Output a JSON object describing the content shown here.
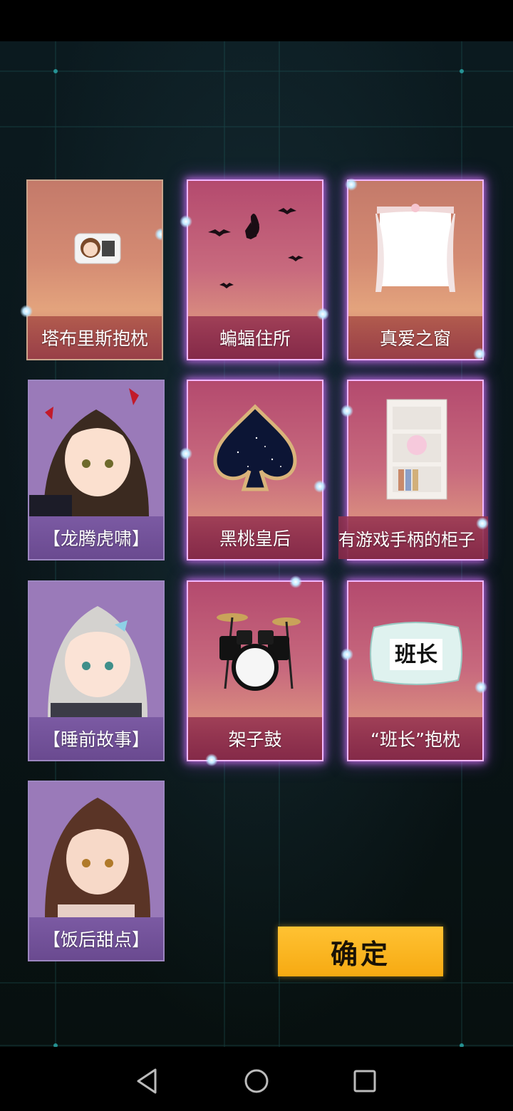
{
  "furniture_cards": [
    {
      "label": "塔布里斯抱枕",
      "icon": "pillow-icon"
    },
    {
      "label": "蝙蝠住所",
      "icon": "bats-icon"
    },
    {
      "label": "真爱之窗",
      "icon": "window-curtain-icon"
    },
    {
      "label": "黑桃皇后",
      "icon": "spade-icon"
    },
    {
      "label": "有游戏手柄的柜子",
      "icon": "bookshelf-icon"
    },
    {
      "label": "架子鼓",
      "icon": "drum-kit-icon"
    },
    {
      "label": "“班长”抱枕",
      "icon": "pillow-icon",
      "pillow_text": "班长"
    }
  ],
  "character_cards": [
    {
      "label": "【龙腾虎啸】",
      "icon": "character-portrait-icon"
    },
    {
      "label": "【睡前故事】",
      "icon": "character-portrait-icon"
    },
    {
      "label": "【饭后甜点】",
      "icon": "character-portrait-icon"
    }
  ],
  "confirm_label": "确定",
  "nav": {
    "back": "back-icon",
    "home": "home-icon",
    "recents": "recents-icon"
  },
  "colors": {
    "confirm": "#f6aa12",
    "glow": "#e08cff",
    "grid": "#1f5a5a"
  }
}
